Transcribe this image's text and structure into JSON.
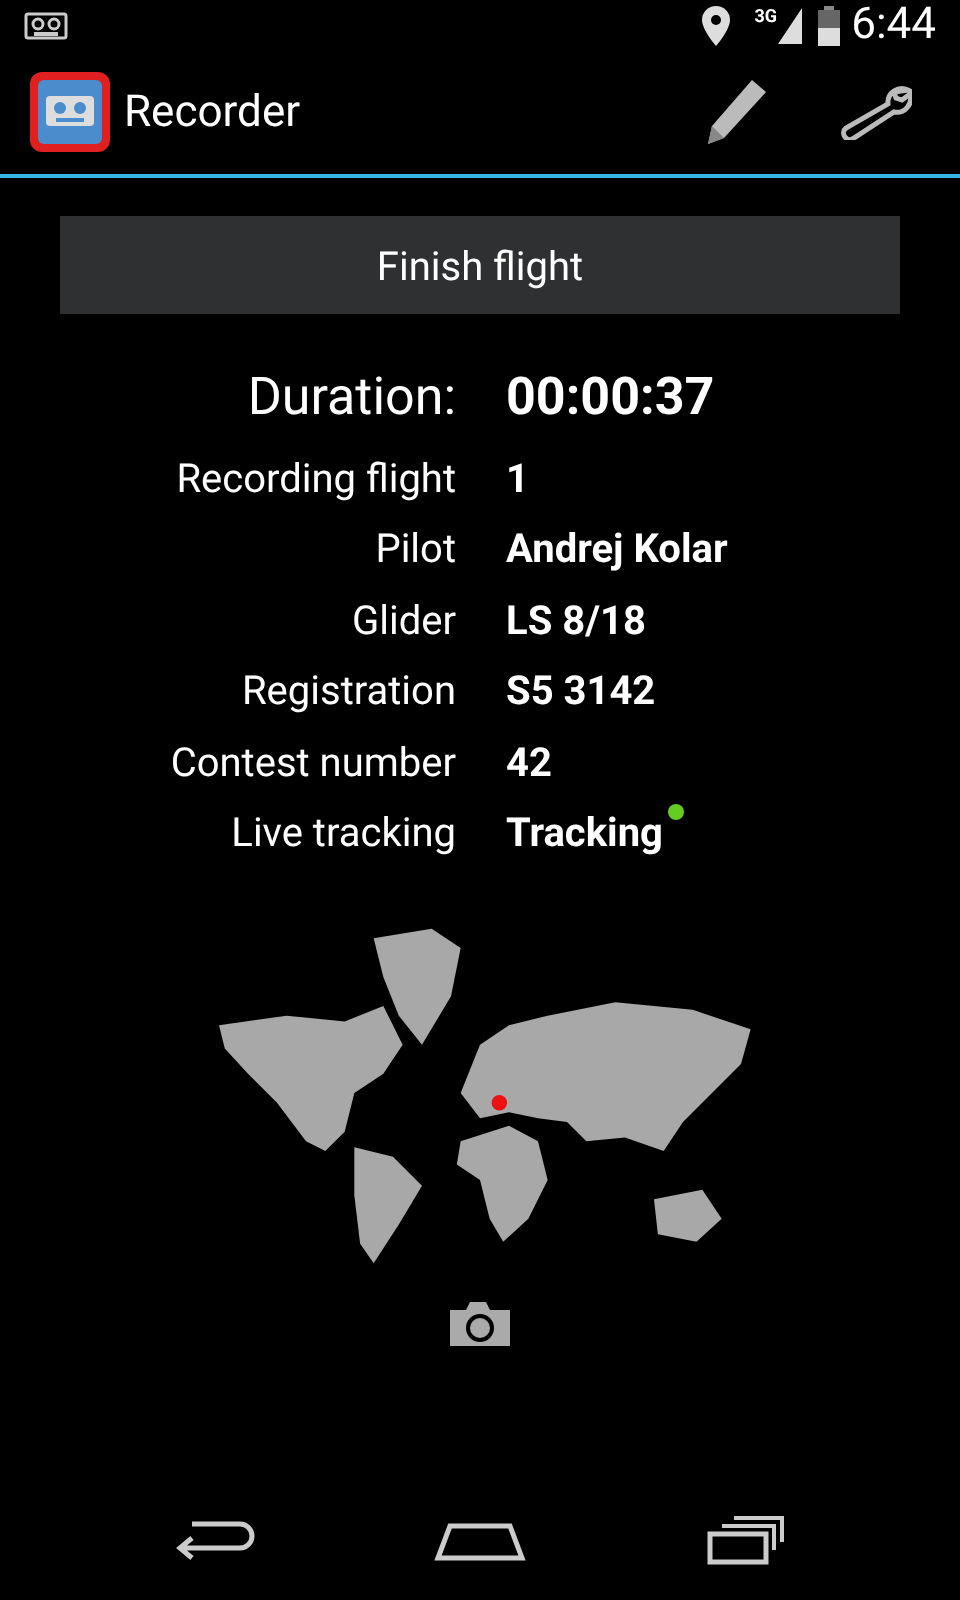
{
  "status_bar": {
    "time": "6:44",
    "network": "3G"
  },
  "action_bar": {
    "title": "Recorder"
  },
  "finish_button": "Finish flight",
  "info_rows": [
    {
      "kind": "large",
      "label": "Duration:",
      "value": "00:00:37"
    },
    {
      "kind": "plain",
      "label": "Recording flight",
      "value": "1"
    },
    {
      "kind": "plain",
      "label": "Pilot",
      "value": "Andrej Kolar"
    },
    {
      "kind": "plain",
      "label": "Glider",
      "value": "LS 8/18"
    },
    {
      "kind": "plain",
      "label": "Registration",
      "value": "S5 3142"
    },
    {
      "kind": "plain",
      "label": "Contest number",
      "value": "42"
    },
    {
      "kind": "status",
      "label": "Live tracking",
      "value": "Tracking",
      "color": "#66cc22"
    }
  ]
}
